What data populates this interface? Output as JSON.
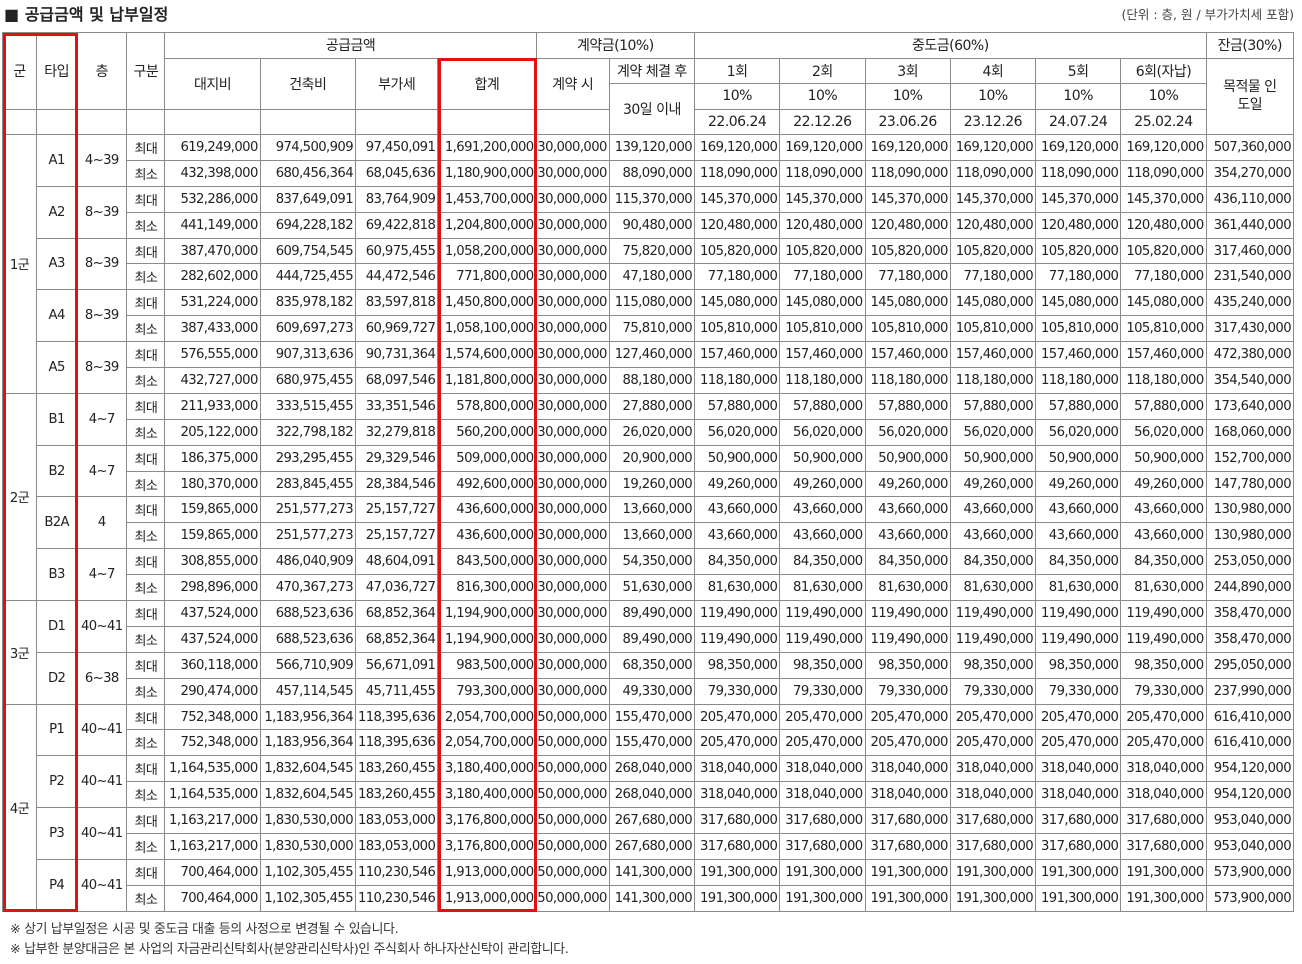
{
  "title": "■ 공급금액 및 납부일정",
  "unit_note": "(단위 : 층, 원 / 부가가치세 포함)",
  "headers": {
    "group": "군",
    "type": "타입",
    "floor": "층",
    "kind": "구분",
    "supply": "공급금액",
    "land": "대지비",
    "building": "건축비",
    "vat": "부가세",
    "total": "합계",
    "deposit": "계약금(10%)",
    "at_contract": "계약 시",
    "after_contract": "계약 체결 후",
    "within30": "30일 이내",
    "middle": "중도금(60%)",
    "installments": [
      {
        "n": "1회",
        "pct": "10%",
        "date": "22.06.24"
      },
      {
        "n": "2회",
        "pct": "10%",
        "date": "22.12.26"
      },
      {
        "n": "3회",
        "pct": "10%",
        "date": "23.06.26"
      },
      {
        "n": "4회",
        "pct": "10%",
        "date": "23.12.26"
      },
      {
        "n": "5회",
        "pct": "10%",
        "date": "24.07.24"
      },
      {
        "n": "6회(자납)",
        "pct": "10%",
        "date": "25.02.24"
      }
    ],
    "balance": "잔금(30%)",
    "balance_sub": "목적물 인도일"
  },
  "groups": [
    {
      "name": "1군",
      "types": [
        {
          "type": "A1",
          "floor": "4~39",
          "rows": [
            [
              "최대",
              "619,249,000",
              "974,500,909",
              "97,450,091",
              "1,691,200,000",
              "30,000,000",
              "139,120,000",
              "169,120,000",
              "169,120,000",
              "169,120,000",
              "169,120,000",
              "169,120,000",
              "169,120,000",
              "507,360,000"
            ],
            [
              "최소",
              "432,398,000",
              "680,456,364",
              "68,045,636",
              "1,180,900,000",
              "30,000,000",
              "88,090,000",
              "118,090,000",
              "118,090,000",
              "118,090,000",
              "118,090,000",
              "118,090,000",
              "118,090,000",
              "354,270,000"
            ]
          ]
        },
        {
          "type": "A2",
          "floor": "8~39",
          "rows": [
            [
              "최대",
              "532,286,000",
              "837,649,091",
              "83,764,909",
              "1,453,700,000",
              "30,000,000",
              "115,370,000",
              "145,370,000",
              "145,370,000",
              "145,370,000",
              "145,370,000",
              "145,370,000",
              "145,370,000",
              "436,110,000"
            ],
            [
              "최소",
              "441,149,000",
              "694,228,182",
              "69,422,818",
              "1,204,800,000",
              "30,000,000",
              "90,480,000",
              "120,480,000",
              "120,480,000",
              "120,480,000",
              "120,480,000",
              "120,480,000",
              "120,480,000",
              "361,440,000"
            ]
          ]
        },
        {
          "type": "A3",
          "floor": "8~39",
          "rows": [
            [
              "최대",
              "387,470,000",
              "609,754,545",
              "60,975,455",
              "1,058,200,000",
              "30,000,000",
              "75,820,000",
              "105,820,000",
              "105,820,000",
              "105,820,000",
              "105,820,000",
              "105,820,000",
              "105,820,000",
              "317,460,000"
            ],
            [
              "최소",
              "282,602,000",
              "444,725,455",
              "44,472,546",
              "771,800,000",
              "30,000,000",
              "47,180,000",
              "77,180,000",
              "77,180,000",
              "77,180,000",
              "77,180,000",
              "77,180,000",
              "77,180,000",
              "231,540,000"
            ]
          ]
        },
        {
          "type": "A4",
          "floor": "8~39",
          "rows": [
            [
              "최대",
              "531,224,000",
              "835,978,182",
              "83,597,818",
              "1,450,800,000",
              "30,000,000",
              "115,080,000",
              "145,080,000",
              "145,080,000",
              "145,080,000",
              "145,080,000",
              "145,080,000",
              "145,080,000",
              "435,240,000"
            ],
            [
              "최소",
              "387,433,000",
              "609,697,273",
              "60,969,727",
              "1,058,100,000",
              "30,000,000",
              "75,810,000",
              "105,810,000",
              "105,810,000",
              "105,810,000",
              "105,810,000",
              "105,810,000",
              "105,810,000",
              "317,430,000"
            ]
          ]
        },
        {
          "type": "A5",
          "floor": "8~39",
          "rows": [
            [
              "최대",
              "576,555,000",
              "907,313,636",
              "90,731,364",
              "1,574,600,000",
              "30,000,000",
              "127,460,000",
              "157,460,000",
              "157,460,000",
              "157,460,000",
              "157,460,000",
              "157,460,000",
              "157,460,000",
              "472,380,000"
            ],
            [
              "최소",
              "432,727,000",
              "680,975,455",
              "68,097,546",
              "1,181,800,000",
              "30,000,000",
              "88,180,000",
              "118,180,000",
              "118,180,000",
              "118,180,000",
              "118,180,000",
              "118,180,000",
              "118,180,000",
              "354,540,000"
            ]
          ]
        }
      ]
    },
    {
      "name": "2군",
      "types": [
        {
          "type": "B1",
          "floor": "4~7",
          "rows": [
            [
              "최대",
              "211,933,000",
              "333,515,455",
              "33,351,546",
              "578,800,000",
              "30,000,000",
              "27,880,000",
              "57,880,000",
              "57,880,000",
              "57,880,000",
              "57,880,000",
              "57,880,000",
              "57,880,000",
              "173,640,000"
            ],
            [
              "최소",
              "205,122,000",
              "322,798,182",
              "32,279,818",
              "560,200,000",
              "30,000,000",
              "26,020,000",
              "56,020,000",
              "56,020,000",
              "56,020,000",
              "56,020,000",
              "56,020,000",
              "56,020,000",
              "168,060,000"
            ]
          ]
        },
        {
          "type": "B2",
          "floor": "4~7",
          "rows": [
            [
              "최대",
              "186,375,000",
              "293,295,455",
              "29,329,546",
              "509,000,000",
              "30,000,000",
              "20,900,000",
              "50,900,000",
              "50,900,000",
              "50,900,000",
              "50,900,000",
              "50,900,000",
              "50,900,000",
              "152,700,000"
            ],
            [
              "최소",
              "180,370,000",
              "283,845,455",
              "28,384,546",
              "492,600,000",
              "30,000,000",
              "19,260,000",
              "49,260,000",
              "49,260,000",
              "49,260,000",
              "49,260,000",
              "49,260,000",
              "49,260,000",
              "147,780,000"
            ]
          ]
        },
        {
          "type": "B2A",
          "floor": "4",
          "rows": [
            [
              "최대",
              "159,865,000",
              "251,577,273",
              "25,157,727",
              "436,600,000",
              "30,000,000",
              "13,660,000",
              "43,660,000",
              "43,660,000",
              "43,660,000",
              "43,660,000",
              "43,660,000",
              "43,660,000",
              "130,980,000"
            ],
            [
              "최소",
              "159,865,000",
              "251,577,273",
              "25,157,727",
              "436,600,000",
              "30,000,000",
              "13,660,000",
              "43,660,000",
              "43,660,000",
              "43,660,000",
              "43,660,000",
              "43,660,000",
              "43,660,000",
              "130,980,000"
            ]
          ]
        },
        {
          "type": "B3",
          "floor": "4~7",
          "rows": [
            [
              "최대",
              "308,855,000",
              "486,040,909",
              "48,604,091",
              "843,500,000",
              "30,000,000",
              "54,350,000",
              "84,350,000",
              "84,350,000",
              "84,350,000",
              "84,350,000",
              "84,350,000",
              "84,350,000",
              "253,050,000"
            ],
            [
              "최소",
              "298,896,000",
              "470,367,273",
              "47,036,727",
              "816,300,000",
              "30,000,000",
              "51,630,000",
              "81,630,000",
              "81,630,000",
              "81,630,000",
              "81,630,000",
              "81,630,000",
              "81,630,000",
              "244,890,000"
            ]
          ]
        }
      ]
    },
    {
      "name": "3군",
      "types": [
        {
          "type": "D1",
          "floor": "40~41",
          "rows": [
            [
              "최대",
              "437,524,000",
              "688,523,636",
              "68,852,364",
              "1,194,900,000",
              "30,000,000",
              "89,490,000",
              "119,490,000",
              "119,490,000",
              "119,490,000",
              "119,490,000",
              "119,490,000",
              "119,490,000",
              "358,470,000"
            ],
            [
              "최소",
              "437,524,000",
              "688,523,636",
              "68,852,364",
              "1,194,900,000",
              "30,000,000",
              "89,490,000",
              "119,490,000",
              "119,490,000",
              "119,490,000",
              "119,490,000",
              "119,490,000",
              "119,490,000",
              "358,470,000"
            ]
          ]
        },
        {
          "type": "D2",
          "floor": "6~38",
          "rows": [
            [
              "최대",
              "360,118,000",
              "566,710,909",
              "56,671,091",
              "983,500,000",
              "30,000,000",
              "68,350,000",
              "98,350,000",
              "98,350,000",
              "98,350,000",
              "98,350,000",
              "98,350,000",
              "98,350,000",
              "295,050,000"
            ],
            [
              "최소",
              "290,474,000",
              "457,114,545",
              "45,711,455",
              "793,300,000",
              "30,000,000",
              "49,330,000",
              "79,330,000",
              "79,330,000",
              "79,330,000",
              "79,330,000",
              "79,330,000",
              "79,330,000",
              "237,990,000"
            ]
          ]
        }
      ]
    },
    {
      "name": "4군",
      "types": [
        {
          "type": "P1",
          "floor": "40~41",
          "rows": [
            [
              "최대",
              "752,348,000",
              "1,183,956,364",
              "118,395,636",
              "2,054,700,000",
              "50,000,000",
              "155,470,000",
              "205,470,000",
              "205,470,000",
              "205,470,000",
              "205,470,000",
              "205,470,000",
              "205,470,000",
              "616,410,000"
            ],
            [
              "최소",
              "752,348,000",
              "1,183,956,364",
              "118,395,636",
              "2,054,700,000",
              "50,000,000",
              "155,470,000",
              "205,470,000",
              "205,470,000",
              "205,470,000",
              "205,470,000",
              "205,470,000",
              "205,470,000",
              "616,410,000"
            ]
          ]
        },
        {
          "type": "P2",
          "floor": "40~41",
          "rows": [
            [
              "최대",
              "1,164,535,000",
              "1,832,604,545",
              "183,260,455",
              "3,180,400,000",
              "50,000,000",
              "268,040,000",
              "318,040,000",
              "318,040,000",
              "318,040,000",
              "318,040,000",
              "318,040,000",
              "318,040,000",
              "954,120,000"
            ],
            [
              "최소",
              "1,164,535,000",
              "1,832,604,545",
              "183,260,455",
              "3,180,400,000",
              "50,000,000",
              "268,040,000",
              "318,040,000",
              "318,040,000",
              "318,040,000",
              "318,040,000",
              "318,040,000",
              "318,040,000",
              "954,120,000"
            ]
          ]
        },
        {
          "type": "P3",
          "floor": "40~41",
          "rows": [
            [
              "최대",
              "1,163,217,000",
              "1,830,530,000",
              "183,053,000",
              "3,176,800,000",
              "50,000,000",
              "267,680,000",
              "317,680,000",
              "317,680,000",
              "317,680,000",
              "317,680,000",
              "317,680,000",
              "317,680,000",
              "953,040,000"
            ],
            [
              "최소",
              "1,163,217,000",
              "1,830,530,000",
              "183,053,000",
              "3,176,800,000",
              "50,000,000",
              "267,680,000",
              "317,680,000",
              "317,680,000",
              "317,680,000",
              "317,680,000",
              "317,680,000",
              "317,680,000",
              "953,040,000"
            ]
          ]
        },
        {
          "type": "P4",
          "floor": "40~41",
          "rows": [
            [
              "최대",
              "700,464,000",
              "1,102,305,455",
              "110,230,546",
              "1,913,000,000",
              "50,000,000",
              "141,300,000",
              "191,300,000",
              "191,300,000",
              "191,300,000",
              "191,300,000",
              "191,300,000",
              "191,300,000",
              "573,900,000"
            ],
            [
              "최소",
              "700,464,000",
              "1,102,305,455",
              "110,230,546",
              "1,913,000,000",
              "50,000,000",
              "141,300,000",
              "191,300,000",
              "191,300,000",
              "191,300,000",
              "191,300,000",
              "191,300,000",
              "191,300,000",
              "573,900,000"
            ]
          ]
        }
      ]
    }
  ],
  "notes": [
    "※ 상기 납부일정은 시공 및 중도금 대출 등의 사정으로 변경될 수 있습니다.",
    "※ 납부한 분양대금은 본 사업의 자금관리신탁회사(분양관리신탁사)인 주식회사 하나자산신탁이 관리합니다."
  ],
  "highlight_color": "#e11111"
}
